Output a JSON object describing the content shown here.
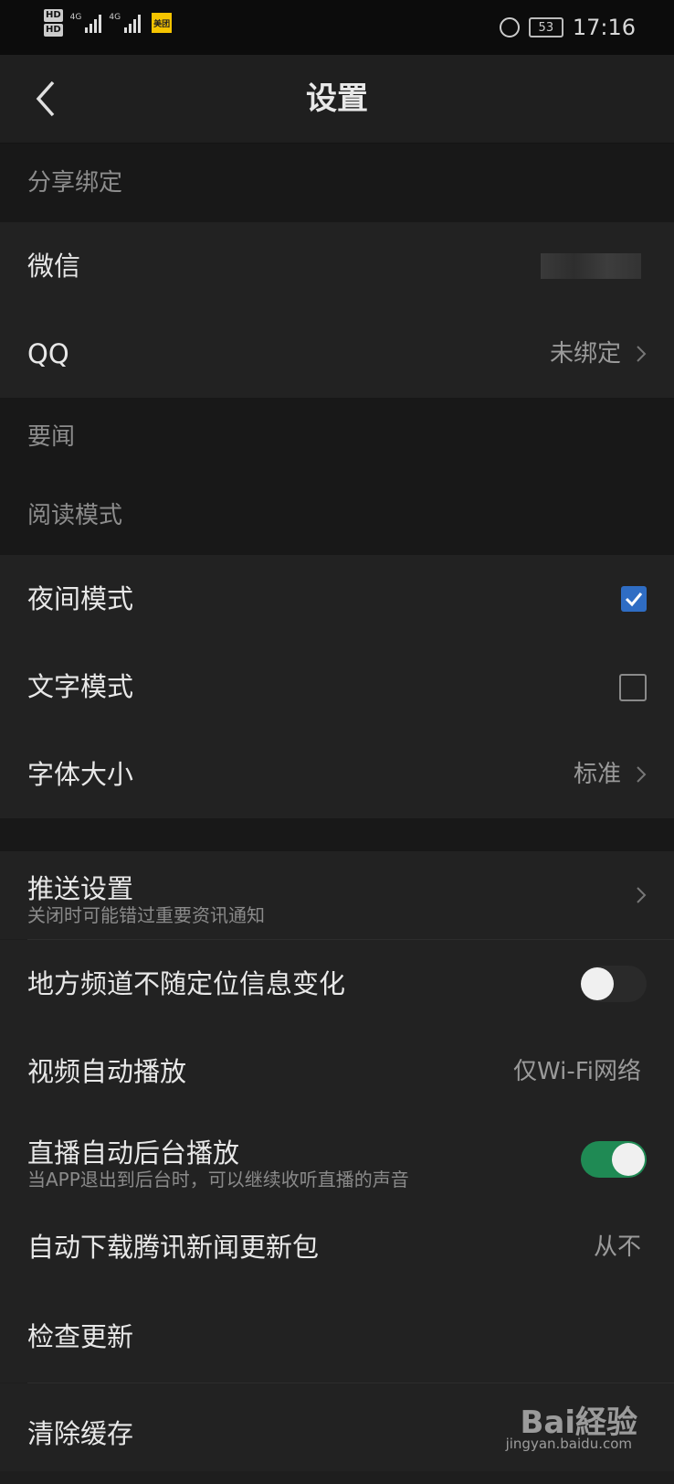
{
  "status_bar": {
    "hd1": "HD",
    "hd2": "HD",
    "net1": "4G",
    "net2": "4G",
    "app_badge": "美团",
    "battery": "53",
    "time": "17:16"
  },
  "nav": {
    "title": "设置"
  },
  "sections": {
    "share": "分享绑定",
    "news": "要闻",
    "reading": "阅读模式"
  },
  "share_rows": {
    "wechat_label": "微信",
    "qq_label": "QQ",
    "qq_value": "未绑定"
  },
  "reading_rows": {
    "night_label": "夜间模式",
    "night_checked": true,
    "text_label": "文字模式",
    "text_checked": false,
    "font_label": "字体大小",
    "font_value": "标准"
  },
  "other_rows": {
    "push_label": "推送设置",
    "push_sub": "关闭时可能错过重要资讯通知",
    "local_label": "地方频道不随定位信息变化",
    "local_on": false,
    "video_label": "视频自动播放",
    "video_value": "仅Wi-Fi网络",
    "live_label": "直播自动后台播放",
    "live_sub": "当APP退出到后台时，可以继续收听直播的声音",
    "live_on": true,
    "download_label": "自动下载腾讯新闻更新包",
    "download_value": "从不",
    "update_label": "检查更新",
    "cache_label": "清除缓存"
  },
  "watermark": {
    "main": "Bai経验",
    "sub": "jingyan.baidu.com"
  },
  "colors": {
    "accent_blue": "#2f6dc4",
    "switch_green": "#1f8a54",
    "background": "#1e1e1e"
  }
}
